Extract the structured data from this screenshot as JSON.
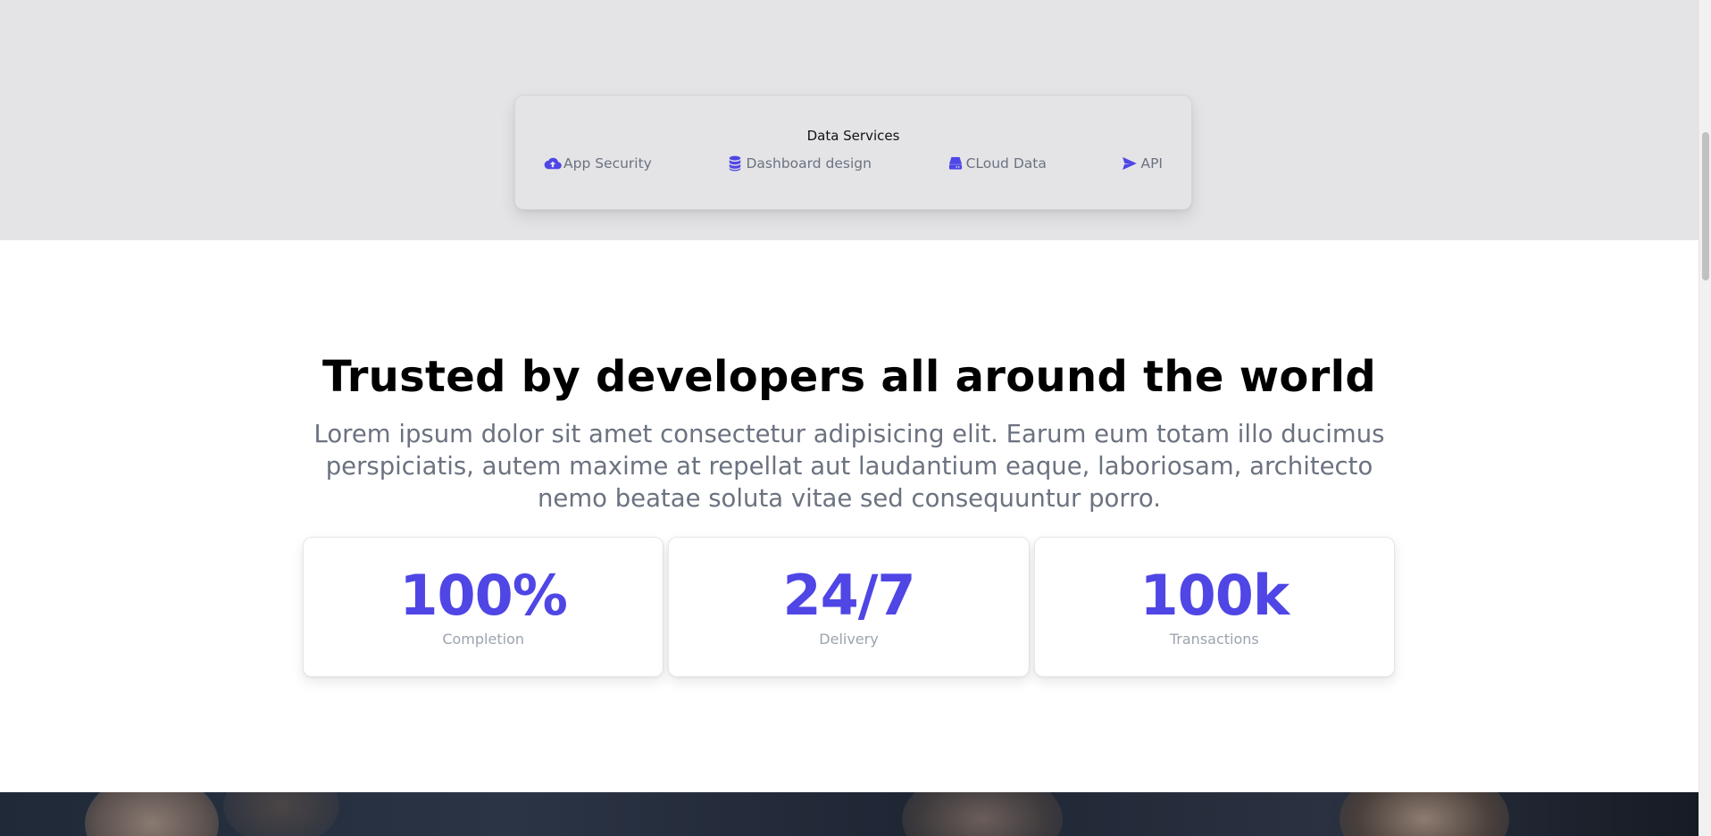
{
  "services": {
    "title": "Data Services",
    "items": [
      {
        "label": "App Security",
        "icon": "cloud-upload-icon"
      },
      {
        "label": "Dashboard design",
        "icon": "database-icon"
      },
      {
        "label": "CLoud Data",
        "icon": "hard-drive-icon"
      },
      {
        "label": "API",
        "icon": "paper-plane-icon"
      }
    ]
  },
  "trusted": {
    "headline": "Trusted by developers all around the world",
    "lede": "Lorem ipsum dolor sit amet consectetur adipisicing elit. Earum eum totam illo ducimus perspiciatis, autem maxime at repellat aut laudantium eaque, laboriosam, architecto nemo beatae soluta vitae sed consequuntur porro."
  },
  "stats": [
    {
      "value": "100%",
      "label": "Completion"
    },
    {
      "value": "24/7",
      "label": "Delivery"
    },
    {
      "value": "100k",
      "label": "Transactions"
    }
  ],
  "colors": {
    "accent": "#4f46e5",
    "muted_text": "#6b7280",
    "band_bg": "#e4e4e7"
  }
}
